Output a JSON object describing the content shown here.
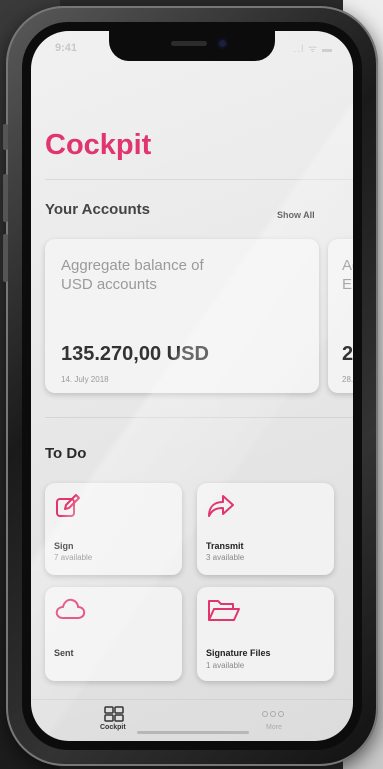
{
  "status_bar": {
    "time": "9:41",
    "icons": "..l ᯤ ▬"
  },
  "app": {
    "title": "Cockpit",
    "accent": "#e0356d"
  },
  "accounts": {
    "heading": "Your Accounts",
    "show_all": "Show All",
    "cards": [
      {
        "desc_line1": "Aggregate balance of",
        "desc_line2": "USD accounts",
        "amount": "135.270,00 USD",
        "date": "14. July 2018"
      },
      {
        "desc_line1": "Ag",
        "desc_line2": "EU",
        "amount": "2",
        "date": "28."
      }
    ]
  },
  "todo": {
    "heading": "To Do",
    "items": [
      {
        "icon": "edit-icon",
        "label": "Sign",
        "sub": "7 available"
      },
      {
        "icon": "share-arrow-icon",
        "label": "Transmit",
        "sub": "3 available"
      },
      {
        "icon": "cloud-icon",
        "label": "Sent",
        "sub": ""
      },
      {
        "icon": "folder-open-icon",
        "label": "Signature Files",
        "sub": "1 available"
      }
    ]
  },
  "tabbar": {
    "tabs": [
      {
        "icon": "grid-icon",
        "label": "Cockpit",
        "active": true
      },
      {
        "icon": "more-dots-icon",
        "label": "More",
        "active": false
      }
    ]
  }
}
